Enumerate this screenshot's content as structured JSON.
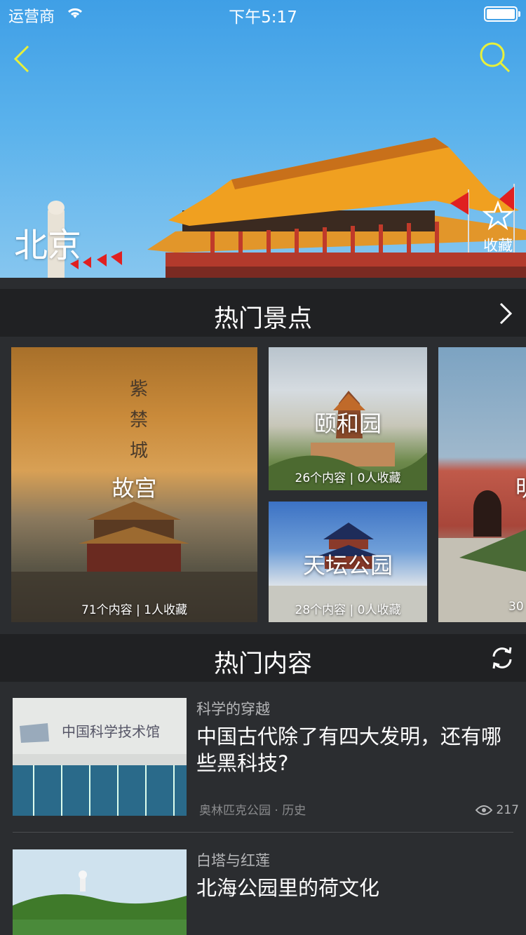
{
  "status_bar": {
    "carrier": "运营商",
    "time": "下午5:17"
  },
  "hero": {
    "city": "北京",
    "favorite_label": "收藏"
  },
  "hot_spots": {
    "title": "热门景点",
    "items": [
      {
        "name": "故宫",
        "meta": "71个内容 | 1人收藏",
        "overlay_text": "紫禁城"
      },
      {
        "name": "颐和园",
        "meta": "26个内容 | 0人收藏"
      },
      {
        "name": "天坛公园",
        "meta": "28个内容 | 0人收藏"
      },
      {
        "name": "明",
        "meta": "30"
      }
    ]
  },
  "hot_content": {
    "title": "热门内容",
    "items": [
      {
        "tag": "科学的穿越",
        "headline": "中国古代除了有四大发明，还有哪些黑科技?",
        "place": "奥林匹克公园 · 历史",
        "views": "217"
      },
      {
        "tag": "白塔与红莲",
        "headline": "北海公园里的荷文化"
      }
    ]
  },
  "colors": {
    "accent": "#e8f03a",
    "panel": "#2b2d30",
    "header": "#202123"
  }
}
